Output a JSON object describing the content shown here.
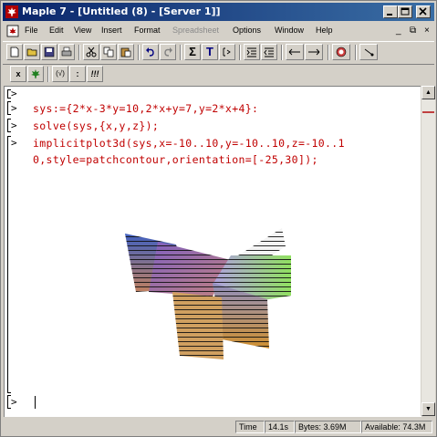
{
  "window": {
    "title": "Maple 7 - [Untitled (8) - [Server 1]]"
  },
  "menubar": {
    "items": [
      {
        "label": "File",
        "enabled": true
      },
      {
        "label": "Edit",
        "enabled": true
      },
      {
        "label": "View",
        "enabled": true
      },
      {
        "label": "Insert",
        "enabled": true
      },
      {
        "label": "Format",
        "enabled": true
      },
      {
        "label": "Spreadsheet",
        "enabled": false
      },
      {
        "label": "Options",
        "enabled": true
      },
      {
        "label": "Window",
        "enabled": true
      },
      {
        "label": "Help",
        "enabled": true
      }
    ]
  },
  "toolbar": {
    "text_button": "T",
    "sigma_button": "Σ",
    "context_x": "x",
    "context_check": "(√)",
    "context_colon": ":",
    "context_excl": "!!!"
  },
  "worksheet": {
    "prompt_symbol": ">",
    "lines": [
      "sys:={2*x-3*y=10,2*x+y=7,y=2*x+4}:",
      "solve(sys,{x,y,z});",
      "implicitplot3d(sys,x=-10..10,y=-10..10,z=-10..1",
      "0,style=patchcontour,orientation=[-25,30]);"
    ]
  },
  "statusbar": {
    "time_label": "Time",
    "time_value": "14.1s",
    "bytes": "Bytes: 3.69M",
    "available": "Available: 74.3M"
  },
  "colors": {
    "titlebar_start": "#0a246a",
    "titlebar_end": "#3a6ea5",
    "input_text": "#c00000",
    "face": "#d4d0c8"
  }
}
